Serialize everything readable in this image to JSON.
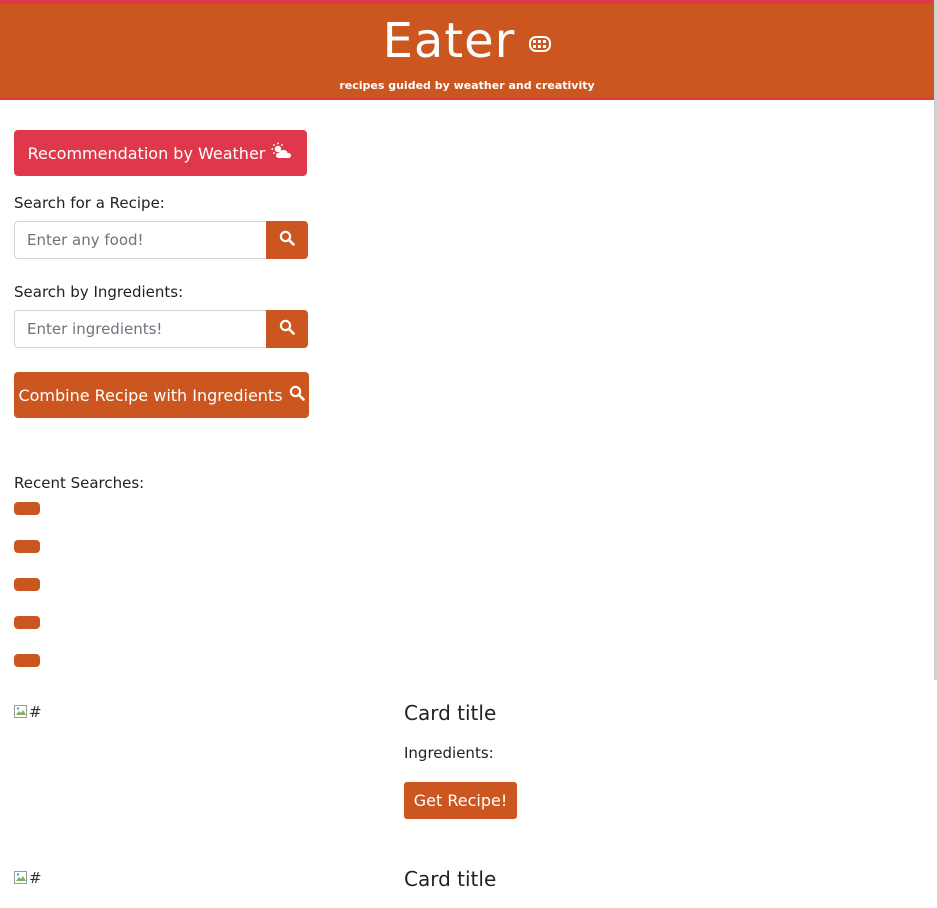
{
  "header": {
    "title": "Eater",
    "subtitle": "recipes guided by weather and creativity",
    "icon": "stroopwafel-icon"
  },
  "weather_button": {
    "label": "Recommendation by Weather",
    "icon": "cloud-sun-icon"
  },
  "recipe_search": {
    "label": "Search for a Recipe:",
    "placeholder": "Enter any food!",
    "button_icon": "search-icon"
  },
  "ingredient_search": {
    "label": "Search by Ingredients:",
    "placeholder": "Enter ingredients!",
    "button_icon": "search-icon"
  },
  "combine_button": {
    "label": "Combine Recipe with Ingredients",
    "icon": "search-icon"
  },
  "recent": {
    "label": "Recent Searches:",
    "items": [
      "",
      "",
      "",
      "",
      ""
    ]
  },
  "cards": [
    {
      "image_alt": "#",
      "title": "Card title",
      "ingredients_label": "Ingredients:",
      "button_label": "Get Recipe!"
    },
    {
      "image_alt": "#",
      "title": "Card title"
    }
  ],
  "colors": {
    "brand": "#cb561f",
    "accent": "#e0384b"
  }
}
